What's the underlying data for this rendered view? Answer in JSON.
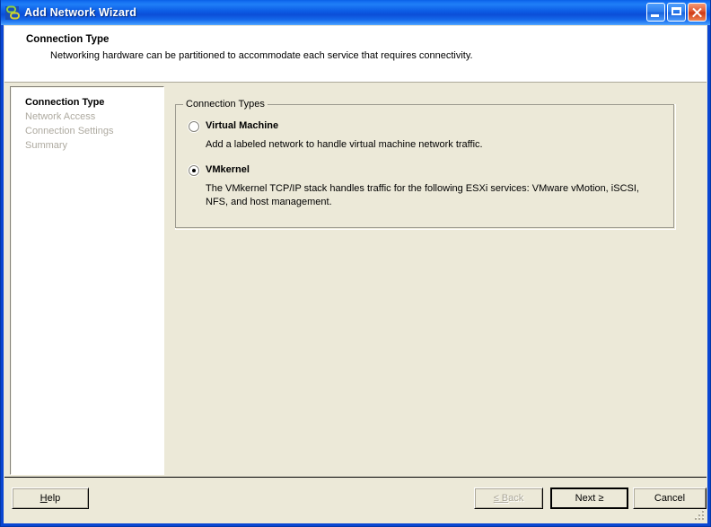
{
  "window": {
    "title": "Add Network Wizard",
    "icon": "network-wizard-icon",
    "controls": {
      "minimize": "minimize-button",
      "maximize": "maximize-button",
      "close": "close-button"
    }
  },
  "header": {
    "title": "Connection Type",
    "subtitle": "Networking hardware can be partitioned to accommodate each service that requires connectivity."
  },
  "sidebar": {
    "items": [
      {
        "label": "Connection Type",
        "active": true
      },
      {
        "label": "Network Access",
        "active": false
      },
      {
        "label": "Connection Settings",
        "active": false
      },
      {
        "label": "Summary",
        "active": false
      }
    ]
  },
  "main": {
    "groupbox": {
      "legend": "Connection Types",
      "options": [
        {
          "label": "Virtual Machine",
          "selected": false,
          "description": "Add a labeled network to handle virtual machine network traffic."
        },
        {
          "label": "VMkernel",
          "selected": true,
          "description": "The VMkernel TCP/IP stack handles traffic for the following ESXi services: VMware vMotion, iSCSI, NFS, and host management."
        }
      ]
    }
  },
  "footer": {
    "help": {
      "prefix": "H",
      "suffix": "elp",
      "disabled": false
    },
    "back": {
      "prefix": "≤ B",
      "suffix": "ack",
      "disabled": true
    },
    "next": {
      "prefix": "Next ≥",
      "suffix": "",
      "disabled": false
    },
    "cancel": {
      "prefix": "Cancel",
      "suffix": "",
      "disabled": false
    }
  },
  "colors": {
    "title_blue": "#0a46d2",
    "face": "#ece9d8",
    "disabled_text": "#aca899",
    "nav_inactive": "#aeaaa0"
  }
}
